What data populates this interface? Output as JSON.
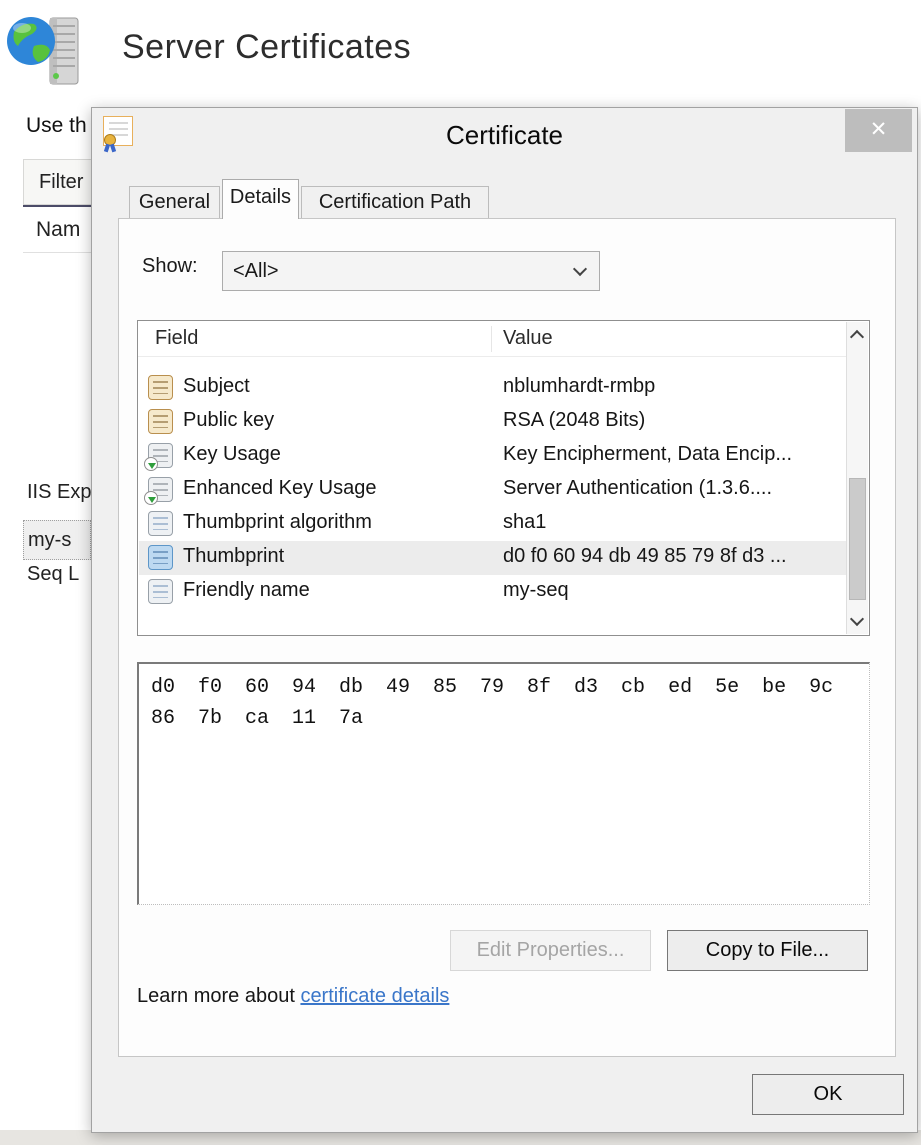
{
  "page": {
    "title": "Server Certificates",
    "intro_partial": "Use th",
    "filter_label": "Filter",
    "name_column_partial": "Nam",
    "items": [
      "IIS Exp",
      "my-s",
      "Seq L"
    ]
  },
  "dialog": {
    "title": "Certificate",
    "close_glyph": "✕",
    "tabs": [
      {
        "label": "General"
      },
      {
        "label": "Details"
      },
      {
        "label": "Certification Path"
      }
    ],
    "show": {
      "label": "Show:",
      "value": "<All>"
    },
    "fields_table": {
      "columns": [
        "Field",
        "Value"
      ],
      "rows": [
        {
          "field": "Subject",
          "value": "nblumhardt-rmbp",
          "icon": "tan",
          "selected": false
        },
        {
          "field": "Public key",
          "value": "RSA (2048 Bits)",
          "icon": "tan",
          "selected": false
        },
        {
          "field": "Key Usage",
          "value": "Key Encipherment, Data Encip...",
          "icon": "keyusage",
          "selected": false
        },
        {
          "field": "Enhanced Key Usage",
          "value": "Server Authentication (1.3.6....",
          "icon": "keyusage",
          "selected": false
        },
        {
          "field": "Thumbprint algorithm",
          "value": "sha1",
          "icon": "gray",
          "selected": false
        },
        {
          "field": "Thumbprint",
          "value": "d0 f0 60 94 db 49 85 79 8f d3 ...",
          "icon": "blue",
          "selected": true
        },
        {
          "field": "Friendly name",
          "value": "my-seq",
          "icon": "gray",
          "selected": false
        }
      ]
    },
    "preview": {
      "lines": [
        "d0 f0 60 94 db 49 85 79 8f d3 cb ed 5e be 9c",
        "86 7b ca 11 7a"
      ]
    },
    "buttons": {
      "edit_properties": "Edit Properties...",
      "copy_to_file": "Copy to File...",
      "ok": "OK"
    },
    "learn_more": {
      "prefix": "Learn more about ",
      "link_text": "certificate details"
    }
  },
  "colors": {
    "link": "#3a76c9",
    "selected_row": "#ececec",
    "close_button_bg": "#bdbdbd",
    "dialog_bg": "#f0f0f0",
    "panel_bg": "#fdfdfd"
  }
}
